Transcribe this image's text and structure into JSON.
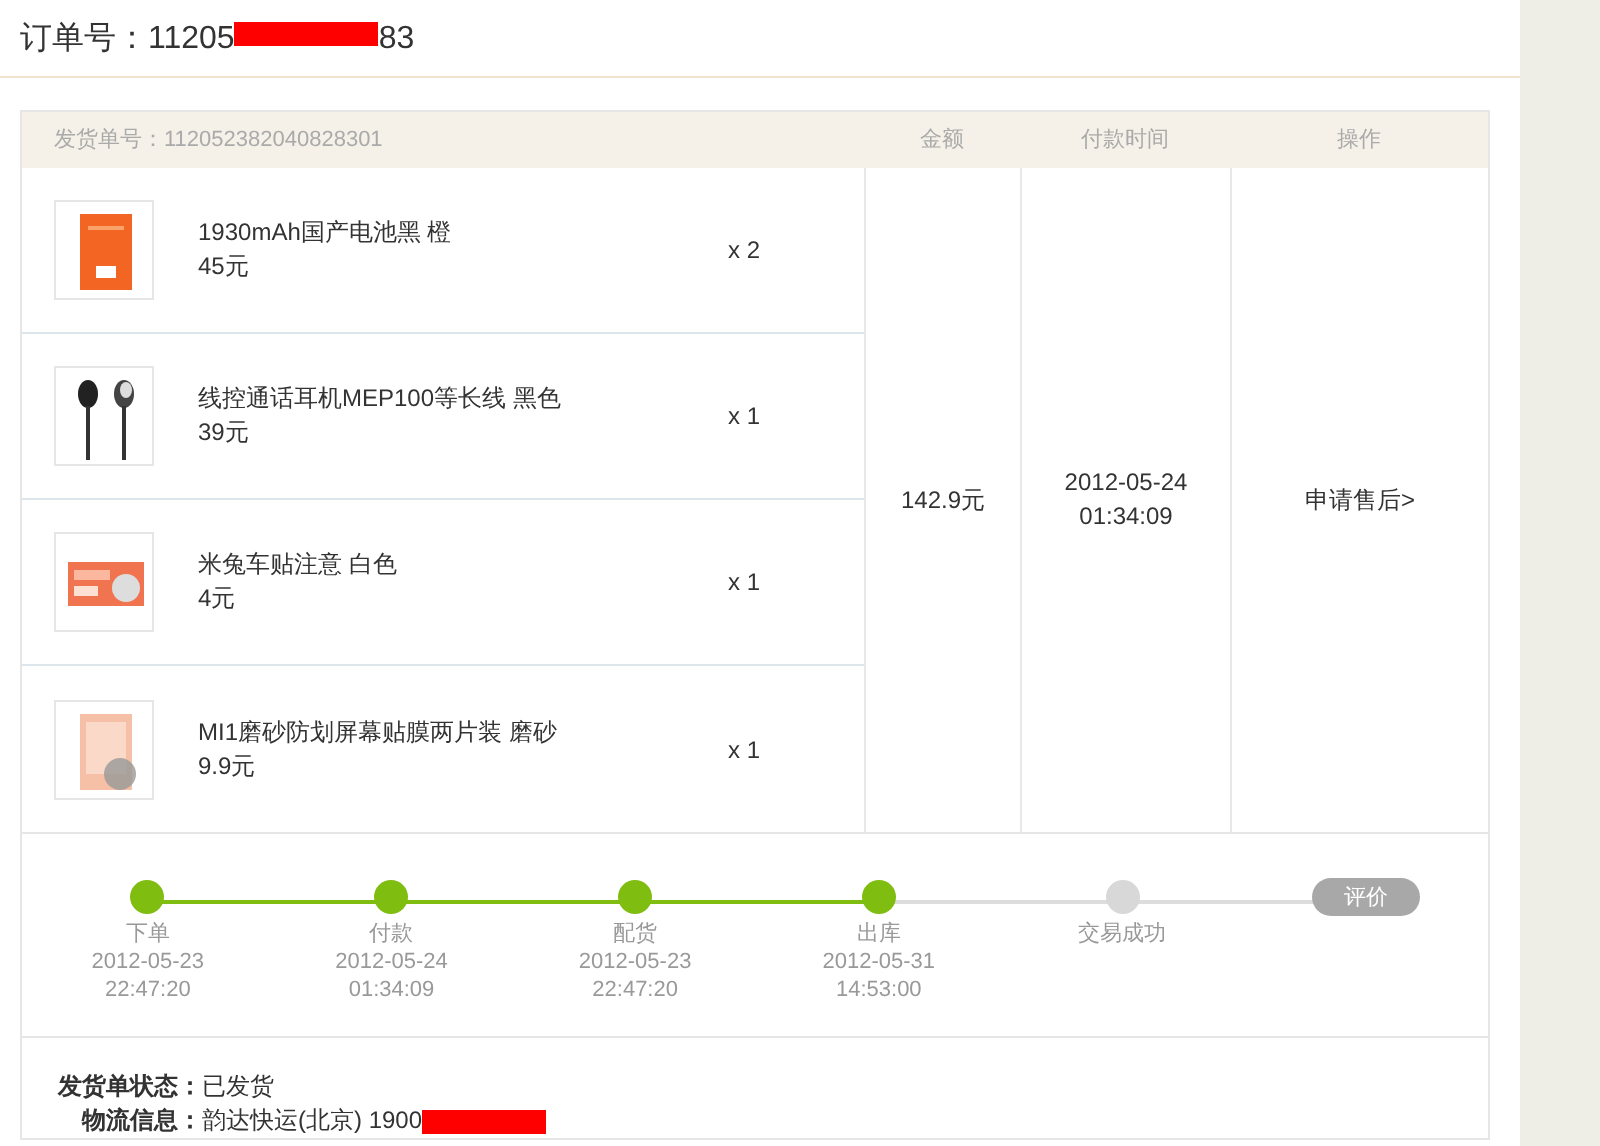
{
  "order": {
    "label": "订单号：",
    "number_start": "11205",
    "number_end": "83",
    "redacted": true
  },
  "shipment": {
    "label": "发货单号：112052382040828301",
    "columns": [
      "金额",
      "付款时间",
      "操作"
    ],
    "items": [
      {
        "name": "1930mAh国产电池黑 橙",
        "price": "45元",
        "qty": "x 2"
      },
      {
        "name": "线控通话耳机MEP100等长线 黑色",
        "price": "39元",
        "qty": "x 1"
      },
      {
        "name": "米兔车贴注意 白色",
        "price": "4元",
        "qty": "x 1"
      },
      {
        "name": "MI1磨砂防划屏幕贴膜两片装 磨砂",
        "price": "9.9元",
        "qty": "x 1"
      }
    ],
    "amount": "142.9元",
    "pay_time": [
      "2012-05-24",
      "01:34:09"
    ],
    "action": "申请售后>"
  },
  "progress": {
    "steps": [
      {
        "label": "下单",
        "date": "2012-05-23",
        "time": "22:47:20",
        "done": true
      },
      {
        "label": "付款",
        "date": "2012-05-24",
        "time": "01:34:09",
        "done": true
      },
      {
        "label": "配货",
        "date": "2012-05-23",
        "time": "22:47:20",
        "done": true
      },
      {
        "label": "出库",
        "date": "2012-05-31",
        "time": "14:53:00",
        "done": true
      },
      {
        "label": "交易成功",
        "done": false
      }
    ],
    "review_button": {
      "label": "评价",
      "disabled": true
    }
  },
  "details": [
    {
      "label": "发货单状态：",
      "value": "已发货"
    },
    {
      "label": "物流信息：",
      "value": "韵达快运(北京) 1900",
      "redacted": true
    }
  ]
}
